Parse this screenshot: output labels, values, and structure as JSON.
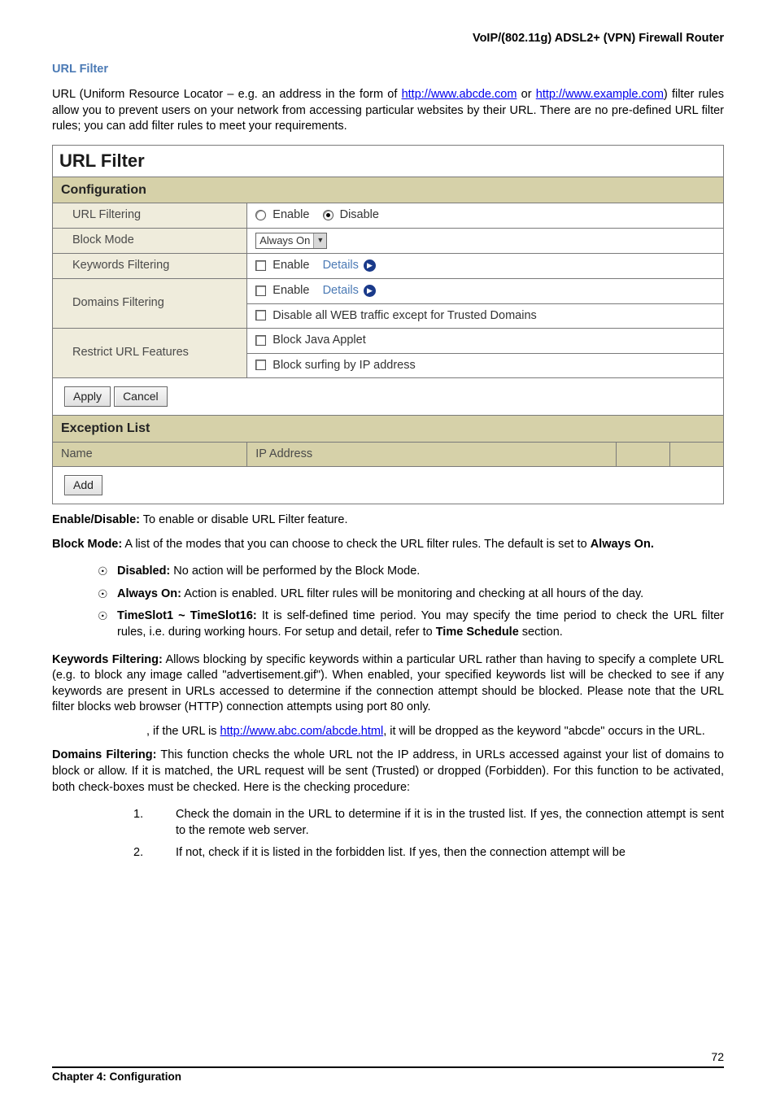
{
  "header_right": "VoIP/(802.11g) ADSL2+ (VPN) Firewall Router",
  "section_heading": "URL Filter",
  "intro": {
    "p1a": "URL (Uniform Resource Locator – e.g. an address in the form of ",
    "link1": "http://www.abcde.com",
    "p1b": " or ",
    "link2": "http://www.example.com",
    "p1c": ") filter rules allow you to prevent users on your network from accessing particular websites by their URL. There are no pre-defined URL filter rules; you can add filter rules to meet your requirements."
  },
  "table": {
    "title": "URL Filter",
    "config_hdr": "Configuration",
    "rows": {
      "url_filtering": "URL Filtering",
      "enable_opt": "Enable",
      "disable_opt": "Disable",
      "block_mode": "Block Mode",
      "block_mode_val": "Always On",
      "keywords_filtering": "Keywords Filtering",
      "kf_enable": "Enable",
      "kf_details": "Details",
      "domains_filtering": "Domains Filtering",
      "df_enable": "Enable",
      "df_details": "Details",
      "df_disable_all": "Disable all WEB traffic except for Trusted Domains",
      "restrict_url": "Restrict URL Features",
      "block_java": "Block Java Applet",
      "block_ip": "Block surfing by IP address"
    },
    "btn_apply": "Apply",
    "btn_cancel": "Cancel",
    "exception_hdr": "Exception List",
    "col_name": "Name",
    "col_ip": "IP Address",
    "btn_add": "Add"
  },
  "body": {
    "enable_disable_lbl": "Enable/Disable:",
    "enable_disable_txt": " To enable or disable URL Filter feature.",
    "block_mode_lbl": "Block Mode:",
    "block_mode_txt_a": " A list of the modes that you can choose to check the URL filter rules. The default is set to ",
    "always_on_lbl": "Always On.",
    "bullets": {
      "b1_lbl": "Disabled:",
      "b1_txt": " No action will be performed by the Block Mode.",
      "b2_lbl": "Always On:",
      "b2_txt": " Action is enabled.   URL filter rules will be monitoring and checking at all hours of the day.",
      "b3_lbl": "TimeSlot1 ~ TimeSlot16:",
      "b3_txt_a": "   It is self-defined time period.   You may specify the time period to check the URL filter rules, i.e. during working hours. For setup and detail, refer to ",
      "b3_txt_b": "Time Schedule",
      "b3_txt_c": " section."
    },
    "keywords_lbl": "Keywords Filtering:",
    "keywords_txt": " Allows blocking by specific keywords within a particular URL rather than having to specify a complete URL (e.g. to block any image called \"advertisement.gif\"). When enabled, your specified keywords list will be checked to see if any keywords are present in URLs accessed to determine if the connection attempt should be blocked. Please note that the URL filter blocks web browser (HTTP) connection attempts using port 80 only.",
    "keywords_ex_a": ", if the URL is ",
    "keywords_ex_link": "http://www.abc.com/abcde.html",
    "keywords_ex_b": ", it will be dropped as the keyword \"abcde\" occurs in the URL.",
    "domains_lbl": "Domains Filtering:",
    "domains_txt": " This function checks the whole URL not the IP address, in URLs accessed against your list of domains to block or allow.   If it is matched, the URL request will be sent (Trusted) or dropped (Forbidden).   For this function to be activated, both check-boxes must be checked.   Here is the checking procedure:",
    "num1": "1.",
    "num1_txt": "Check the domain in the URL to determine if it is in the trusted list. If yes, the connection attempt is sent to the remote web server.",
    "num2": "2.",
    "num2_txt": "If not, check if it is listed in the forbidden list.   If yes, then the connection attempt will be"
  },
  "footer": {
    "pagenum": "72",
    "chapter": "Chapter 4: Configuration"
  }
}
